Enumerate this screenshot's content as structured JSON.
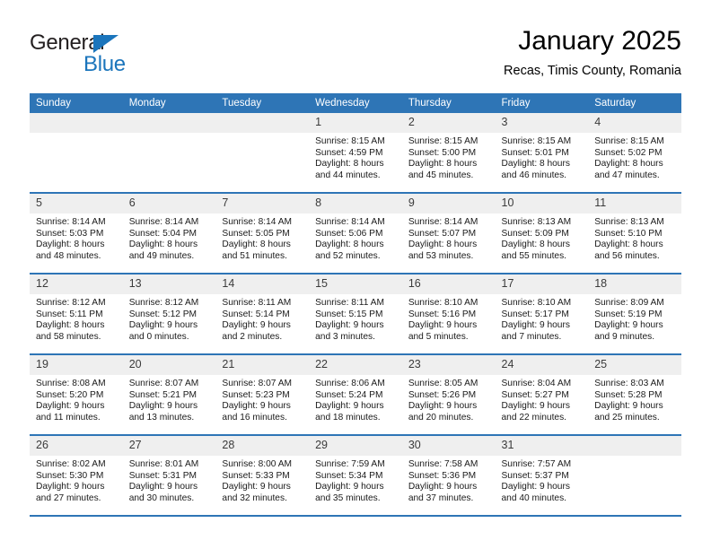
{
  "brand": {
    "name_part1": "General",
    "name_part2": "Blue",
    "accent_color": "#1b75bc"
  },
  "header": {
    "title": "January 2025",
    "subtitle": "Recas, Timis County, Romania"
  },
  "theme": {
    "header_row_bg": "#2e75b6",
    "day_band_bg": "#efefef",
    "row_divider": "#2e75b6"
  },
  "weekdays": [
    "Sunday",
    "Monday",
    "Tuesday",
    "Wednesday",
    "Thursday",
    "Friday",
    "Saturday"
  ],
  "weeks": [
    [
      {
        "day": "",
        "sunrise": "",
        "sunset": "",
        "daylight_line1": "",
        "daylight_line2": ""
      },
      {
        "day": "",
        "sunrise": "",
        "sunset": "",
        "daylight_line1": "",
        "daylight_line2": ""
      },
      {
        "day": "",
        "sunrise": "",
        "sunset": "",
        "daylight_line1": "",
        "daylight_line2": ""
      },
      {
        "day": "1",
        "sunrise": "Sunrise: 8:15 AM",
        "sunset": "Sunset: 4:59 PM",
        "daylight_line1": "Daylight: 8 hours",
        "daylight_line2": "and 44 minutes."
      },
      {
        "day": "2",
        "sunrise": "Sunrise: 8:15 AM",
        "sunset": "Sunset: 5:00 PM",
        "daylight_line1": "Daylight: 8 hours",
        "daylight_line2": "and 45 minutes."
      },
      {
        "day": "3",
        "sunrise": "Sunrise: 8:15 AM",
        "sunset": "Sunset: 5:01 PM",
        "daylight_line1": "Daylight: 8 hours",
        "daylight_line2": "and 46 minutes."
      },
      {
        "day": "4",
        "sunrise": "Sunrise: 8:15 AM",
        "sunset": "Sunset: 5:02 PM",
        "daylight_line1": "Daylight: 8 hours",
        "daylight_line2": "and 47 minutes."
      }
    ],
    [
      {
        "day": "5",
        "sunrise": "Sunrise: 8:14 AM",
        "sunset": "Sunset: 5:03 PM",
        "daylight_line1": "Daylight: 8 hours",
        "daylight_line2": "and 48 minutes."
      },
      {
        "day": "6",
        "sunrise": "Sunrise: 8:14 AM",
        "sunset": "Sunset: 5:04 PM",
        "daylight_line1": "Daylight: 8 hours",
        "daylight_line2": "and 49 minutes."
      },
      {
        "day": "7",
        "sunrise": "Sunrise: 8:14 AM",
        "sunset": "Sunset: 5:05 PM",
        "daylight_line1": "Daylight: 8 hours",
        "daylight_line2": "and 51 minutes."
      },
      {
        "day": "8",
        "sunrise": "Sunrise: 8:14 AM",
        "sunset": "Sunset: 5:06 PM",
        "daylight_line1": "Daylight: 8 hours",
        "daylight_line2": "and 52 minutes."
      },
      {
        "day": "9",
        "sunrise": "Sunrise: 8:14 AM",
        "sunset": "Sunset: 5:07 PM",
        "daylight_line1": "Daylight: 8 hours",
        "daylight_line2": "and 53 minutes."
      },
      {
        "day": "10",
        "sunrise": "Sunrise: 8:13 AM",
        "sunset": "Sunset: 5:09 PM",
        "daylight_line1": "Daylight: 8 hours",
        "daylight_line2": "and 55 minutes."
      },
      {
        "day": "11",
        "sunrise": "Sunrise: 8:13 AM",
        "sunset": "Sunset: 5:10 PM",
        "daylight_line1": "Daylight: 8 hours",
        "daylight_line2": "and 56 minutes."
      }
    ],
    [
      {
        "day": "12",
        "sunrise": "Sunrise: 8:12 AM",
        "sunset": "Sunset: 5:11 PM",
        "daylight_line1": "Daylight: 8 hours",
        "daylight_line2": "and 58 minutes."
      },
      {
        "day": "13",
        "sunrise": "Sunrise: 8:12 AM",
        "sunset": "Sunset: 5:12 PM",
        "daylight_line1": "Daylight: 9 hours",
        "daylight_line2": "and 0 minutes."
      },
      {
        "day": "14",
        "sunrise": "Sunrise: 8:11 AM",
        "sunset": "Sunset: 5:14 PM",
        "daylight_line1": "Daylight: 9 hours",
        "daylight_line2": "and 2 minutes."
      },
      {
        "day": "15",
        "sunrise": "Sunrise: 8:11 AM",
        "sunset": "Sunset: 5:15 PM",
        "daylight_line1": "Daylight: 9 hours",
        "daylight_line2": "and 3 minutes."
      },
      {
        "day": "16",
        "sunrise": "Sunrise: 8:10 AM",
        "sunset": "Sunset: 5:16 PM",
        "daylight_line1": "Daylight: 9 hours",
        "daylight_line2": "and 5 minutes."
      },
      {
        "day": "17",
        "sunrise": "Sunrise: 8:10 AM",
        "sunset": "Sunset: 5:17 PM",
        "daylight_line1": "Daylight: 9 hours",
        "daylight_line2": "and 7 minutes."
      },
      {
        "day": "18",
        "sunrise": "Sunrise: 8:09 AM",
        "sunset": "Sunset: 5:19 PM",
        "daylight_line1": "Daylight: 9 hours",
        "daylight_line2": "and 9 minutes."
      }
    ],
    [
      {
        "day": "19",
        "sunrise": "Sunrise: 8:08 AM",
        "sunset": "Sunset: 5:20 PM",
        "daylight_line1": "Daylight: 9 hours",
        "daylight_line2": "and 11 minutes."
      },
      {
        "day": "20",
        "sunrise": "Sunrise: 8:07 AM",
        "sunset": "Sunset: 5:21 PM",
        "daylight_line1": "Daylight: 9 hours",
        "daylight_line2": "and 13 minutes."
      },
      {
        "day": "21",
        "sunrise": "Sunrise: 8:07 AM",
        "sunset": "Sunset: 5:23 PM",
        "daylight_line1": "Daylight: 9 hours",
        "daylight_line2": "and 16 minutes."
      },
      {
        "day": "22",
        "sunrise": "Sunrise: 8:06 AM",
        "sunset": "Sunset: 5:24 PM",
        "daylight_line1": "Daylight: 9 hours",
        "daylight_line2": "and 18 minutes."
      },
      {
        "day": "23",
        "sunrise": "Sunrise: 8:05 AM",
        "sunset": "Sunset: 5:26 PM",
        "daylight_line1": "Daylight: 9 hours",
        "daylight_line2": "and 20 minutes."
      },
      {
        "day": "24",
        "sunrise": "Sunrise: 8:04 AM",
        "sunset": "Sunset: 5:27 PM",
        "daylight_line1": "Daylight: 9 hours",
        "daylight_line2": "and 22 minutes."
      },
      {
        "day": "25",
        "sunrise": "Sunrise: 8:03 AM",
        "sunset": "Sunset: 5:28 PM",
        "daylight_line1": "Daylight: 9 hours",
        "daylight_line2": "and 25 minutes."
      }
    ],
    [
      {
        "day": "26",
        "sunrise": "Sunrise: 8:02 AM",
        "sunset": "Sunset: 5:30 PM",
        "daylight_line1": "Daylight: 9 hours",
        "daylight_line2": "and 27 minutes."
      },
      {
        "day": "27",
        "sunrise": "Sunrise: 8:01 AM",
        "sunset": "Sunset: 5:31 PM",
        "daylight_line1": "Daylight: 9 hours",
        "daylight_line2": "and 30 minutes."
      },
      {
        "day": "28",
        "sunrise": "Sunrise: 8:00 AM",
        "sunset": "Sunset: 5:33 PM",
        "daylight_line1": "Daylight: 9 hours",
        "daylight_line2": "and 32 minutes."
      },
      {
        "day": "29",
        "sunrise": "Sunrise: 7:59 AM",
        "sunset": "Sunset: 5:34 PM",
        "daylight_line1": "Daylight: 9 hours",
        "daylight_line2": "and 35 minutes."
      },
      {
        "day": "30",
        "sunrise": "Sunrise: 7:58 AM",
        "sunset": "Sunset: 5:36 PM",
        "daylight_line1": "Daylight: 9 hours",
        "daylight_line2": "and 37 minutes."
      },
      {
        "day": "31",
        "sunrise": "Sunrise: 7:57 AM",
        "sunset": "Sunset: 5:37 PM",
        "daylight_line1": "Daylight: 9 hours",
        "daylight_line2": "and 40 minutes."
      },
      {
        "day": "",
        "sunrise": "",
        "sunset": "",
        "daylight_line1": "",
        "daylight_line2": ""
      }
    ]
  ]
}
